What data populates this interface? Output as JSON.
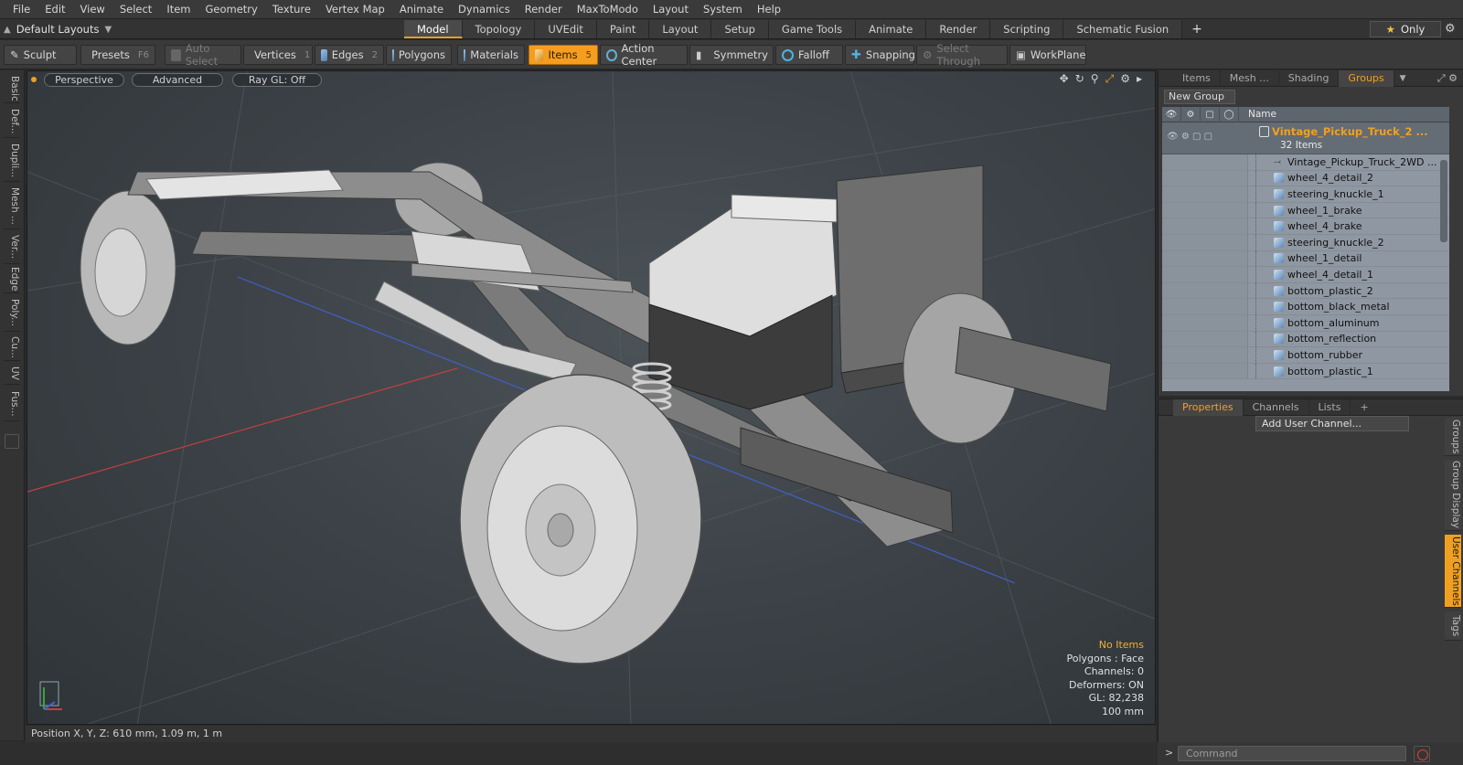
{
  "menu": [
    "File",
    "Edit",
    "View",
    "Select",
    "Item",
    "Geometry",
    "Texture",
    "Vertex Map",
    "Animate",
    "Dynamics",
    "Render",
    "MaxToModo",
    "Layout",
    "System",
    "Help"
  ],
  "layout": {
    "dropdown_label": "Default Layouts",
    "tabs": [
      "Model",
      "Topology",
      "UVEdit",
      "Paint",
      "Layout",
      "Setup",
      "Game Tools",
      "Animate",
      "Render",
      "Scripting",
      "Schematic Fusion"
    ],
    "active_tab": "Model",
    "only_label": "Only"
  },
  "toolbar": {
    "sculpt": "Sculpt",
    "presets": "Presets",
    "presets_key": "F6",
    "auto_select": "Auto Select",
    "vertices": "Vertices",
    "vertices_key": "1",
    "edges": "Edges",
    "edges_key": "2",
    "polygons": "Polygons",
    "materials": "Materials",
    "items": "Items",
    "items_key": "5",
    "action_center": "Action Center",
    "symmetry": "Symmetry",
    "falloff": "Falloff",
    "snapping": "Snapping",
    "select_through": "Select Through",
    "workplane": "WorkPlane"
  },
  "left_tabs": [
    "Basic",
    "Def...",
    "Dupli...",
    "Mesh ...",
    "Ver...",
    "Edge",
    "Poly...",
    "Cu...",
    "UV",
    "Fus..."
  ],
  "viewport": {
    "view_mode": "Perspective",
    "shading": "Advanced",
    "raygl": "Ray GL: Off",
    "info": {
      "selection": "No Items",
      "polygons": "Polygons : Face",
      "channels": "Channels: 0",
      "deformers": "Deformers: ON",
      "gl": "GL: 82,238",
      "grid": "100 mm"
    }
  },
  "status": {
    "position": "Position X, Y, Z:   610 mm, 1.09 m, 1 m"
  },
  "right_panel": {
    "tabs": [
      "Items",
      "Mesh ...",
      "Shading",
      "Groups"
    ],
    "active_tab": "Groups",
    "new_group": "New Group",
    "name_header": "Name",
    "group": {
      "title": "Vintage_Pickup_Truck_2 ...",
      "count": "32 Items"
    },
    "items": [
      {
        "name": "Vintage_Pickup_Truck_2WD ...",
        "icon": "locator-icon"
      },
      {
        "name": "wheel_4_detail_2",
        "icon": "mesh-icon"
      },
      {
        "name": "steering_knuckle_1",
        "icon": "mesh-icon"
      },
      {
        "name": "wheel_1_brake",
        "icon": "mesh-icon"
      },
      {
        "name": "wheel_4_brake",
        "icon": "mesh-icon"
      },
      {
        "name": "steering_knuckle_2",
        "icon": "mesh-icon"
      },
      {
        "name": "wheel_1_detail",
        "icon": "mesh-icon"
      },
      {
        "name": "wheel_4_detail_1",
        "icon": "mesh-icon"
      },
      {
        "name": "bottom_plastic_2",
        "icon": "mesh-icon"
      },
      {
        "name": "bottom_black_metal",
        "icon": "mesh-icon"
      },
      {
        "name": "bottom_aluminum",
        "icon": "mesh-icon"
      },
      {
        "name": "bottom_reflection",
        "icon": "mesh-icon"
      },
      {
        "name": "bottom_rubber",
        "icon": "mesh-icon"
      },
      {
        "name": "bottom_plastic_1",
        "icon": "mesh-icon"
      }
    ]
  },
  "properties_panel": {
    "tabs": [
      "Properties",
      "Channels",
      "Lists"
    ],
    "active_tab": "Properties",
    "add_user_channel": "Add User Channel...",
    "side_tabs": [
      "Groups",
      "Group Display",
      "User Channels",
      "Tags"
    ],
    "active_side_tab": "User Channels"
  },
  "command": {
    "prompt": ">",
    "placeholder": "Command"
  },
  "colors": {
    "accent": "#f0a020",
    "viewport_bg": "#3d4348"
  }
}
